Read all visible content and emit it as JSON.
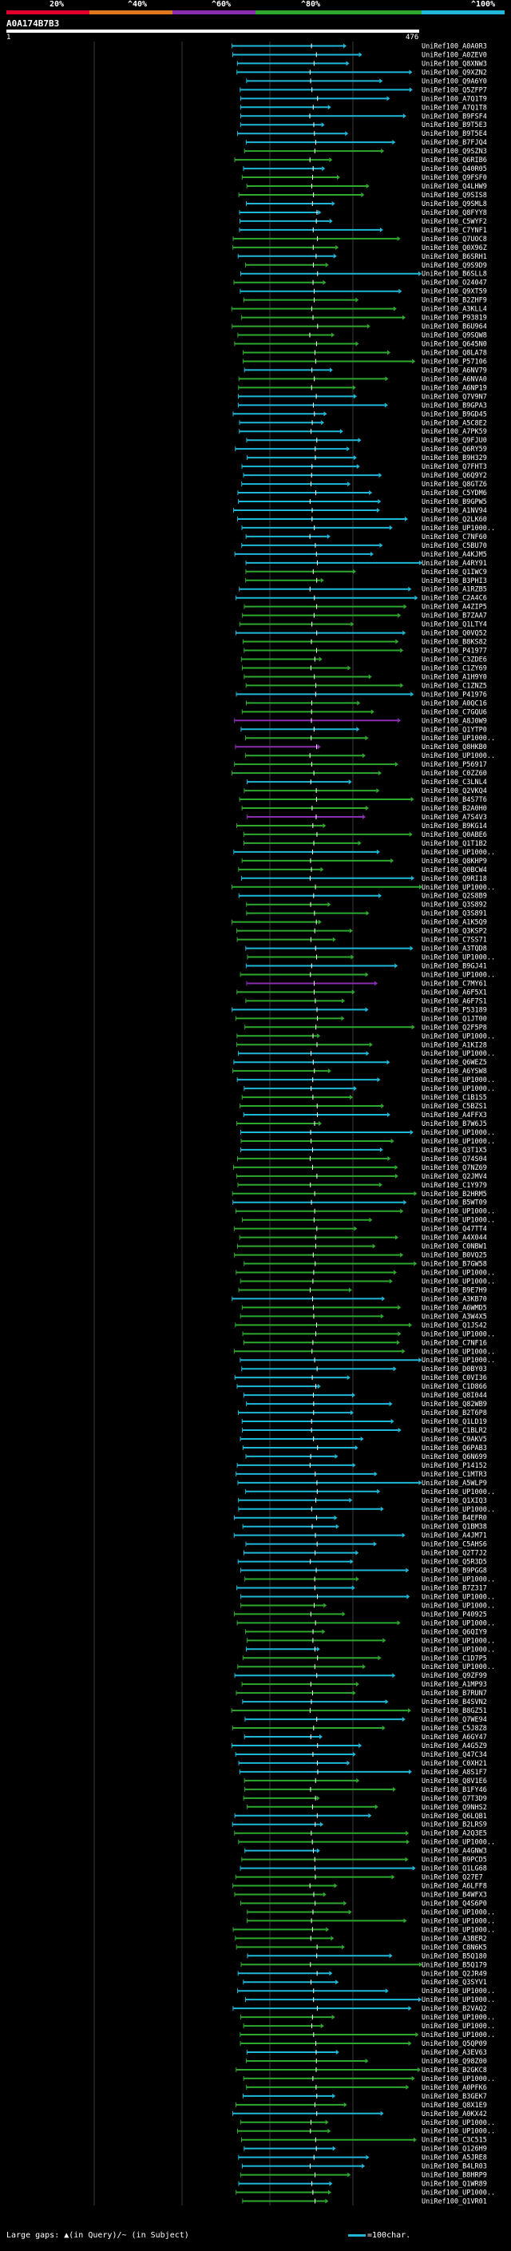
{
  "scale": {
    "labels": [
      "20%",
      "^40%",
      "^60%",
      "^80%",
      "^100%"
    ]
  },
  "colors": {
    "red": "#e0002a",
    "orange": "#e07820",
    "purple": "#8a2db0",
    "green": "#2ea82e",
    "cyan": "#20b8d8",
    "background": "#000000",
    "grid": "#3a3a3a",
    "query": "#ffffff"
  },
  "query": {
    "name": "A0A174B7B3",
    "start": "1",
    "end": "476"
  },
  "footer": {
    "gap_legend": "Large gaps: ▲(in Query)/~ (in Subject)",
    "scale_legend": "=100char."
  },
  "chart_data": {
    "type": "alignment",
    "query_length": 476,
    "hits": [
      "UniRef100_A0A0R3",
      "UniRef100_A0ZEV0",
      "UniRef100_Q8XNW3",
      "UniRef100_Q9XZN2",
      "UniRef100_Q9A6Y0",
      "UniRef100_Q5ZFP7",
      "UniRef100_A7Q1T9",
      "UniRef100_A7Q1T8",
      "UniRef100_B9FSF4",
      "UniRef100_B9T5E3",
      "UniRef100_B9T5E4",
      "UniRef100_B7FJQ4",
      "UniRef100_Q9SZN3",
      "UniRef100_Q6RIB6",
      "UniRef100_Q40R05",
      "UniRef100_Q9FSF0",
      "UniRef100_Q4LHW9",
      "UniRef100_Q9SIS8",
      "UniRef100_Q9SML8",
      "UniRef100_Q8FYY8",
      "UniRef100_C5WYF2",
      "UniRef100_C7YNF1",
      "UniRef100_Q7UOC8",
      "UniRef100_Q0X96Z",
      "UniRef100_B6SRH1",
      "UniRef100_Q9S9D9",
      "UniRef100_B6SLL8",
      "UniRef100_O24047",
      "UniRef100_Q9XT59",
      "UniRef100_B2ZHF9",
      "UniRef100_A3KLL4",
      "UniRef100_P93819",
      "UniRef100_B6U964",
      "UniRef100_Q9SQW8",
      "UniRef100_Q645N0",
      "UniRef100_Q8LA78",
      "UniRef100_P57106",
      "UniRef100_A6NV79",
      "UniRef100_A6NVA0",
      "UniRef100_A6NP19",
      "UniRef100_Q7V9N7",
      "UniRef100_B9GPA3",
      "UniRef100_B9GD45",
      "UniRef100_A5C8E2",
      "UniRef100_A7PK59",
      "UniRef100_Q9FJU0",
      "UniRef100_Q6RY59",
      "UniRef100_B9H329",
      "UniRef100_Q7FHT3",
      "UniRef100_Q6Q9Y2",
      "UniRef100_Q8GTZ6",
      "UniRef100_C5YDM6",
      "UniRef100_B9GPW5",
      "UniRef100_A1NV94",
      "UniRef100_Q2LK60",
      "UniRef100_UP1000..",
      "UniRef100_C7NF60",
      "UniRef100_C5BU70",
      "UniRef100_A4KJM5",
      "UniRef100_A4RY91",
      "UniRef100_Q1IWC9",
      "UniRef100_B3PHI3",
      "UniRef100_A1RZB5",
      "UniRef100_C2A4C6",
      "UniRef100_A4ZIP5",
      "UniRef100_B7ZAA7",
      "UniRef100_Q1LTY4",
      "UniRef100_Q0VQ52",
      "UniRef100_B8KS82",
      "UniRef100_P41977",
      "UniRef100_C3ZDE6",
      "UniRef100_C1ZY69",
      "UniRef100_A1H9Y0",
      "UniRef100_C1ZNZ5",
      "UniRef100_P41976",
      "UniRef100_A0QC16",
      "UniRef100_C7GQU6",
      "UniRef100_A8J0W9",
      "UniRef100_Q1YTP0",
      "UniRef100_UP1000..",
      "UniRef100_Q8HKB0",
      "UniRef100_UP1000..",
      "UniRef100_P56917",
      "UniRef100_C0ZZ60",
      "UniRef100_C3LNL4",
      "UniRef100_Q2VKQ4",
      "UniRef100_B4S7T6",
      "UniRef100_B2A0H0",
      "UniRef100_A7S4V3",
      "UniRef100_B9KG14",
      "UniRef100_Q0ABE6",
      "UniRef100_Q1T1B2",
      "UniRef100_UP1000..",
      "UniRef100_Q8KHP9",
      "UniRef100_Q0BCW4",
      "UniRef100_Q9RI18",
      "UniRef100_UP1000..",
      "UniRef100_Q2S8B9",
      "UniRef100_Q3S892",
      "UniRef100_Q3S891",
      "UniRef100_A1K5Q9",
      "UniRef100_Q3KSP2",
      "UniRef100_C7SS71",
      "UniRef100_A3TQD8",
      "UniRef100_UP1000..",
      "UniRef100_B9GJ41",
      "UniRef100_UP1000..",
      "UniRef100_C7MY61",
      "UniRef100_A6F5X1",
      "UniRef100_A6F7S1",
      "UniRef100_P53189",
      "UniRef100_Q1JT00",
      "UniRef100_Q2F5P8",
      "UniRef100_UP1000..",
      "UniRef100_A1KI28",
      "UniRef100_UP1000..",
      "UniRef100_Q6WEZ5",
      "UniRef100_A6YSW8",
      "UniRef100_UP1000..",
      "UniRef100_UP1000..",
      "UniRef100_C1B1S5",
      "UniRef100_C5BZS1",
      "UniRef100_A4FFX3",
      "UniRef100_B7W6J5",
      "UniRef100_UP1000..",
      "UniRef100_UP1000..",
      "UniRef100_Q3T1X5",
      "UniRef100_Q74S04",
      "UniRef100_Q7NZ69",
      "UniRef100_Q2JMV4",
      "UniRef100_C1Y979",
      "UniRef100_B2HRM5",
      "UniRef100_B5WT09",
      "UniRef100_UP1000..",
      "UniRef100_UP1000..",
      "UniRef100_Q47TT4",
      "UniRef100_A4X044",
      "UniRef100_C0NBW1",
      "UniRef100_B0VQ25",
      "UniRef100_B7GW58",
      "UniRef100_UP1000..",
      "UniRef100_UP1000..",
      "UniRef100_B9E7H9",
      "UniRef100_A3KB70",
      "UniRef100_A6WMD5",
      "UniRef100_A3W4X5",
      "UniRef100_Q1JS42",
      "UniRef100_UP1000..",
      "UniRef100_C7NF16",
      "UniRef100_UP1000..",
      "UniRef100_UP1000..",
      "UniRef100_D0BY03",
      "UniRef100_C0VI36",
      "UniRef100_C1D866",
      "UniRef100_Q8I044",
      "UniRef100_Q82WB9",
      "UniRef100_B2T6P8",
      "UniRef100_Q1LD19",
      "UniRef100_C1BLR2",
      "UniRef100_C9AKV5",
      "UniRef100_Q6PAB3",
      "UniRef100_Q6N699",
      "UniRef100_P14152",
      "UniRef100_C1MTR3",
      "UniRef100_A5WLP9",
      "UniRef100_UP1000..",
      "UniRef100_Q1XIQ3",
      "UniRef100_UP1000..",
      "UniRef100_B4EFR0",
      "UniRef100_Q1BM38",
      "UniRef100_A4JM71",
      "UniRef100_C5AHS6",
      "UniRef100_Q2T7J2",
      "UniRef100_Q5R3D5",
      "UniRef100_B9PGG8",
      "UniRef100_UP1000..",
      "UniRef100_B7Z317",
      "UniRef100_UP1000..",
      "UniRef100_UP1000..",
      "UniRef100_P40925",
      "UniRef100_UP1000..",
      "UniRef100_Q6QIY9",
      "UniRef100_UP1000..",
      "UniRef100_UP1000..",
      "UniRef100_C1D7P5",
      "UniRef100_UP1000..",
      "UniRef100_Q9ZF99",
      "UniRef100_A1MP93",
      "UniRef100_B7RUN7",
      "UniRef100_B4SVN2",
      "UniRef100_B8GZ51",
      "UniRef100_Q7WE94",
      "UniRef100_C5J8Z8",
      "UniRef100_A6GY47",
      "UniRef100_A4G5Z9",
      "UniRef100_Q47C34",
      "UniRef100_C0XH21",
      "UniRef100_A8S1F7",
      "UniRef100_Q8V1E6",
      "UniRef100_B1FY46",
      "UniRef100_Q7T3D9",
      "UniRef100_Q9NHS2",
      "UniRef100_Q6LQB1",
      "UniRef100_B2LRS9",
      "UniRef100_A2Q3E5",
      "UniRef100_UP1000..",
      "UniRef100_A4GNW3",
      "UniRef100_B9PCD5",
      "UniRef100_Q1LG68",
      "UniRef100_Q27E7",
      "UniRef100_A6LFF8",
      "UniRef100_B4WFX3",
      "UniRef100_Q4S6P0",
      "UniRef100_UP1000..",
      "UniRef100_UP1000..",
      "UniRef100_UP1000..",
      "UniRef100_A3BER2",
      "UniRef100_C8N6K5",
      "UniRef100_B5Q180",
      "UniRef100_B5Q179",
      "UniRef100_Q2JR49",
      "UniRef100_Q3SYV1",
      "UniRef100_UP1000..",
      "UniRef100_UP1000..",
      "UniRef100_B2VAQ2",
      "UniRef100_UP1000..",
      "UniRef100_UP1000..",
      "UniRef100_UP1000..",
      "UniRef100_Q5QP09",
      "UniRef100_A3EV63",
      "UniRef100_Q98Z00",
      "UniRef100_B2GKC8",
      "UniRef100_UP1000..",
      "UniRef100_A0PFK6",
      "UniRef100_B3GEK7",
      "UniRef100_Q8X1E9",
      "UniRef100_A0KX42",
      "UniRef100_UP1000..",
      "UniRef100_UP1000..",
      "UniRef100_C3C515",
      "UniRef100_Q126H9",
      "UniRef100_A5JRE8",
      "UniRef100_B4LR03",
      "UniRef100_B8HRP9",
      "UniRef100_Q1WR89",
      "UniRef100_UP1000..",
      "UniRef100_Q1VR01"
    ]
  }
}
